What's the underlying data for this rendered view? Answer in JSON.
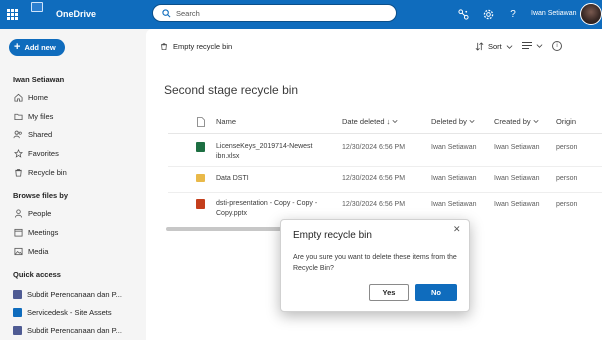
{
  "topbar": {
    "app_name": "OneDrive",
    "search_placeholder": "Search",
    "user_name": "Iwan Setiawan",
    "icons": [
      "app-launcher-icon",
      "onedrive-logo-icon",
      "search-icon",
      "share-link-icon",
      "settings-icon",
      "help-icon",
      "avatar"
    ],
    "brand_color": "#0f6cbd"
  },
  "leftnav": {
    "add_new_label": "Add new",
    "owner_name": "Iwan Setiawan",
    "items": [
      {
        "label": "Home",
        "icon": "home-icon"
      },
      {
        "label": "My files",
        "icon": "folder-icon"
      },
      {
        "label": "Shared",
        "icon": "people-icon"
      },
      {
        "label": "Favorites",
        "icon": "star-icon"
      },
      {
        "label": "Recycle bin",
        "icon": "trash-icon"
      }
    ],
    "browse_heading": "Browse files by",
    "browse_items": [
      {
        "label": "People",
        "icon": "person-icon"
      },
      {
        "label": "Meetings",
        "icon": "calendar-icon"
      },
      {
        "label": "Media",
        "icon": "image-icon"
      }
    ],
    "quick_heading": "Quick access",
    "quick_items": [
      {
        "label": "Subdit Perencanaan dan P...",
        "color": "#4f5b93"
      },
      {
        "label": "Servicedesk - Site Assets",
        "color": "#0f6cbd"
      },
      {
        "label": "Subdit Perencanaan dan P...",
        "color": "#4f5b93"
      }
    ]
  },
  "commandbar": {
    "empty_label": "Empty recycle bin",
    "sort_label": "Sort"
  },
  "page": {
    "title": "Second stage recycle bin"
  },
  "table": {
    "headers": {
      "name": "Name",
      "date_deleted": "Date deleted",
      "deleted_by": "Deleted by",
      "created_by": "Created by",
      "original": "Origin"
    },
    "rows": [
      {
        "name_line1": "LicenseKeys_2019714-Newest",
        "name_line2": "ibn.xlsx",
        "type": "excel",
        "date": "12/30/2024 6:56 PM",
        "deleted_by": "Iwan Setiawan",
        "created_by": "Iwan Setiawan",
        "original": "person"
      },
      {
        "name_line1": "Data DSTI",
        "name_line2": "",
        "type": "folder",
        "date": "12/30/2024 6:56 PM",
        "deleted_by": "Iwan Setiawan",
        "created_by": "Iwan Setiawan",
        "original": "person"
      },
      {
        "name_line1": "dsti-presentation - Copy - Copy -",
        "name_line2": "Copy.pptx",
        "type": "powerpoint",
        "date": "12/30/2024 6:56 PM",
        "deleted_by": "Iwan Setiawan",
        "created_by": "Iwan Setiawan",
        "original": "person"
      }
    ]
  },
  "dialog": {
    "title": "Empty recycle bin",
    "body": "Are you sure you want to delete these items from the Recycle Bin?",
    "yes_label": "Yes",
    "no_label": "No"
  }
}
